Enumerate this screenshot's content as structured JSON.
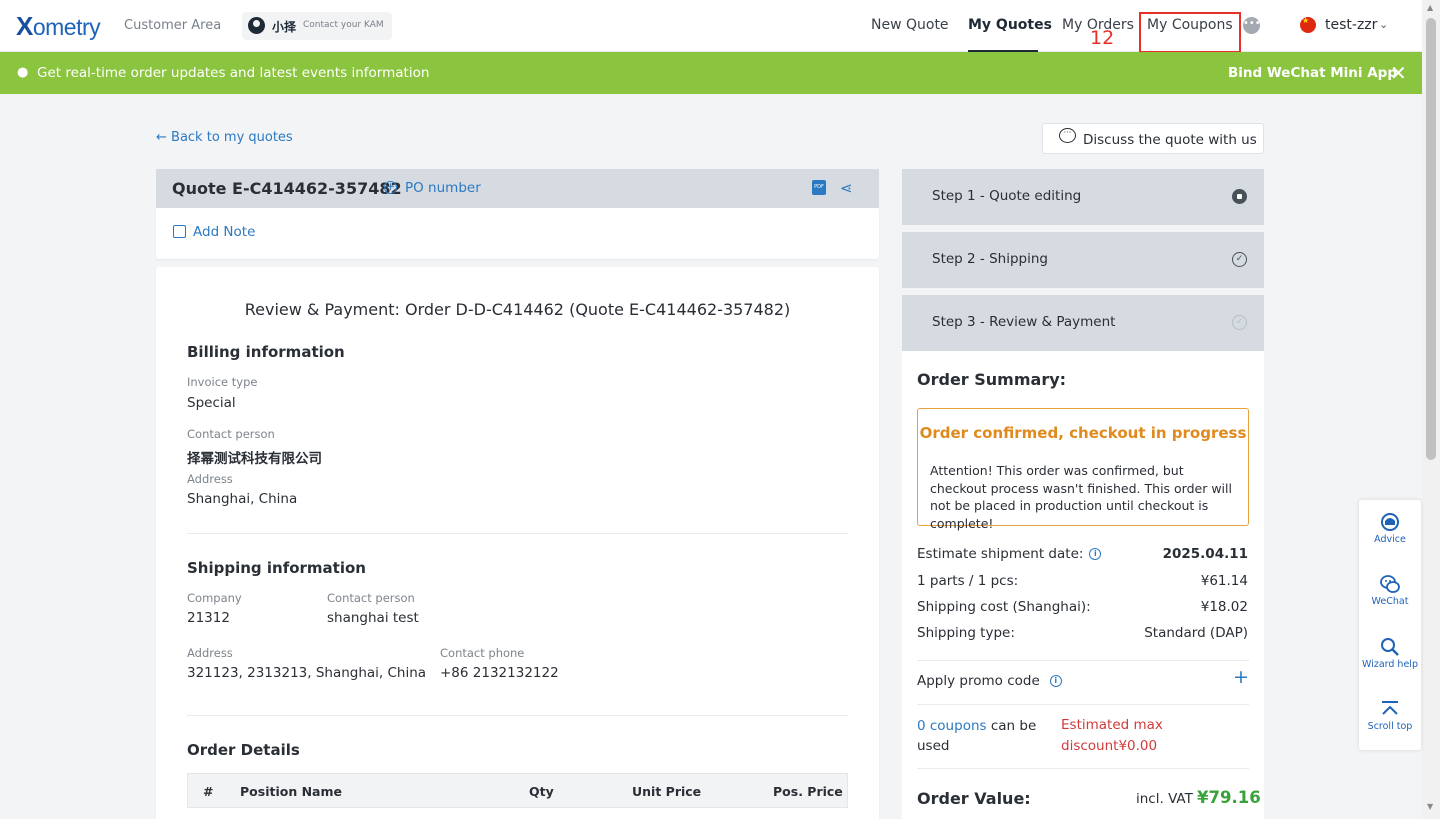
{
  "header": {
    "logo_prefix": "X",
    "logo_rest": "ometry",
    "customer_area": "Customer Area",
    "kam_name": "小择",
    "kam_contact": "Contact your KAM",
    "nav": {
      "new_quote": "New Quote",
      "my_quotes": "My Quotes",
      "my_orders": "My Orders",
      "my_coupons": "My Coupons"
    },
    "annotation_number": "12",
    "chat_dots": "•••",
    "user": "test-zzr"
  },
  "banner": {
    "text": "Get real-time order updates and latest events information",
    "bind": "Bind WeChat Mini App",
    "close": "✕"
  },
  "back_link": "← Back to my quotes",
  "discuss": "Discuss the quote with us",
  "quote": {
    "title": "Quote E-C414462-357482",
    "po_number": "PO number",
    "add_note": "Add Note"
  },
  "review": {
    "title": "Review & Payment: Order D-D-C414462 (Quote E-C414462-357482)",
    "billing": {
      "title": "Billing information",
      "invoice_type_label": "Invoice type",
      "invoice_type": "Special",
      "contact_label": "Contact person",
      "contact": "择幂测试科技有限公司",
      "address_label": "Address",
      "address": "Shanghai, China"
    },
    "shipping": {
      "title": "Shipping information",
      "company_label": "Company",
      "company": "21312",
      "contact_label": "Contact person",
      "contact": "shanghai test",
      "address_label": "Address",
      "address": "321123, 2313213, Shanghai, China",
      "phone_label": "Contact phone",
      "phone": "+86 2132132122"
    },
    "order_details": {
      "title": "Order Details",
      "columns": [
        "#",
        "Position Name",
        "Qty",
        "Unit Price",
        "Pos. Price"
      ]
    }
  },
  "steps": [
    {
      "label": "Step 1 - Quote editing"
    },
    {
      "label": "Step 2 - Shipping"
    },
    {
      "label": "Step 3 - Review & Payment"
    }
  ],
  "summary": {
    "title": "Order Summary:",
    "warn_title": "Order confirmed, checkout in progress",
    "warn_text": "Attention! This order was confirmed, but checkout process wasn't finished. This order will not be placed in production until checkout is complete!",
    "shipment_date_label": "Estimate shipment date:",
    "shipment_date": "2025.04.11",
    "parts_label": "1 parts / 1 pcs:",
    "parts_value": "¥61.14",
    "shipping_cost_label": "Shipping cost (Shanghai):",
    "shipping_cost": "¥18.02",
    "shipping_type_label": "Shipping type:",
    "shipping_type": "Standard (DAP)",
    "promo_label": "Apply promo code",
    "coupons_count": "0 coupons",
    "coupons_rest": " can be used",
    "max_discount": "Estimated max discount¥0.00",
    "order_value_label": "Order Value:",
    "incl_vat": "incl. VAT",
    "total": "¥79.16"
  },
  "side_tools": [
    {
      "label": "Advice"
    },
    {
      "label": "WeChat"
    },
    {
      "label": "Wizard help"
    },
    {
      "label": "Scroll top"
    }
  ],
  "colors": {
    "brand_blue": "#1e63b8",
    "link_blue": "#2b79c2",
    "banner_green": "#8bc43f",
    "warning_orange": "#e08a1e",
    "discount_red": "#d23b3b",
    "total_green": "#3aa23a",
    "annotation_red": "#e5312a"
  }
}
